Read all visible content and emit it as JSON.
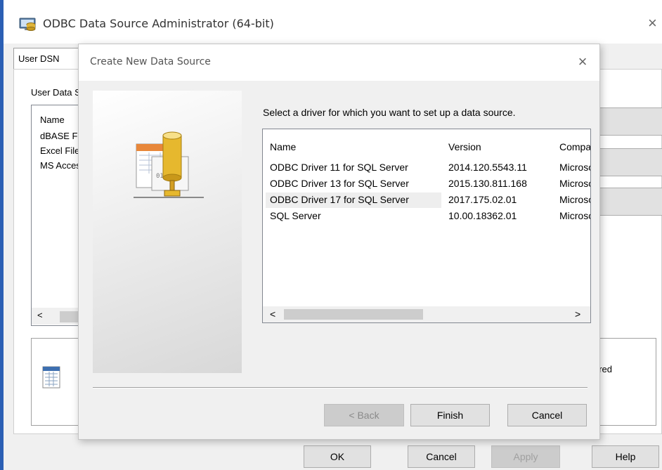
{
  "main_window": {
    "title": "ODBC Data Source Administrator (64-bit)",
    "close_glyph": "×",
    "tabs": [
      {
        "label": "User DSN"
      }
    ],
    "panel_heading": "User Data Sources:",
    "list": {
      "column": "Name",
      "rows": [
        "dBASE Files",
        "Excel Files",
        "MS Access Database"
      ],
      "scroll_left": "<"
    },
    "info_text": "ured",
    "buttons": {
      "ok": "OK",
      "cancel": "Cancel",
      "apply": "Apply",
      "help": "Help"
    },
    "accent_color": "#2b5fb4"
  },
  "dialog": {
    "title": "Create New Data Source",
    "close_glyph": "×",
    "prompt": "Select a driver for which you want to set up a data source.",
    "columns": [
      "Name",
      "Version",
      "Company"
    ],
    "drivers": [
      {
        "name": "ODBC Driver 11 for SQL Server",
        "version": "2014.120.5543.11",
        "company": "Microsoft Corporation"
      },
      {
        "name": "ODBC Driver 13 for SQL Server",
        "version": "2015.130.811.168",
        "company": "Microsoft Corporation"
      },
      {
        "name": "ODBC Driver 17 for SQL Server",
        "version": "2017.175.02.01",
        "company": "Microsoft Corporation"
      },
      {
        "name": "SQL Server",
        "version": "10.00.18362.01",
        "company": "Microsoft Corporation"
      }
    ],
    "hovered_row": 2,
    "scroll": {
      "left": "<",
      "right": ">"
    },
    "buttons": {
      "back": "< Back",
      "finish": "Finish",
      "cancel": "Cancel"
    },
    "icons": {
      "title": "odbc-administrator-icon",
      "wizard": "database-driver-icon",
      "info": "data-source-icon"
    }
  }
}
